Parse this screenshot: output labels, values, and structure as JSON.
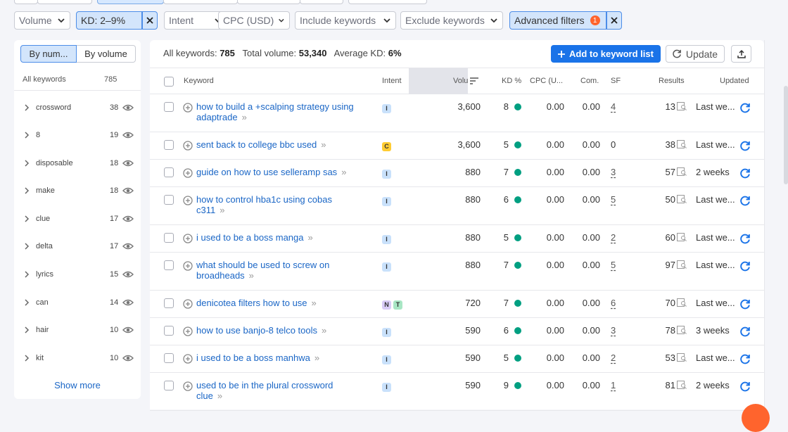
{
  "filters": {
    "volume": "Volume",
    "kd": "KD: 2–9%",
    "intent": "Intent",
    "cpc": "CPC (USD)",
    "include": "Include keywords",
    "exclude": "Exclude keywords",
    "advanced": "Advanced filters",
    "advanced_count": "1"
  },
  "left_panel": {
    "toggle_by_number": "By num...",
    "toggle_by_volume": "By volume",
    "header_label": "All keywords",
    "header_count": "785",
    "groups": [
      {
        "word": "crossword",
        "count": "38"
      },
      {
        "word": "8",
        "count": "19"
      },
      {
        "word": "disposable",
        "count": "18"
      },
      {
        "word": "make",
        "count": "18"
      },
      {
        "word": "clue",
        "count": "17"
      },
      {
        "word": "delta",
        "count": "17"
      },
      {
        "word": "lyrics",
        "count": "15"
      },
      {
        "word": "can",
        "count": "14"
      },
      {
        "word": "hair",
        "count": "10"
      },
      {
        "word": "kit",
        "count": "10"
      }
    ],
    "show_more": "Show more"
  },
  "summary": {
    "all_keywords_label": "All keywords:",
    "all_keywords_value": "785",
    "total_volume_label": "Total volume:",
    "total_volume_value": "53,340",
    "avg_kd_label": "Average KD:",
    "avg_kd_value": "6%"
  },
  "actions": {
    "add_to_list": "Add to keyword list",
    "update": "Update"
  },
  "columns": {
    "keyword": "Keyword",
    "intent": "Intent",
    "volume": "Volu",
    "kd": "KD %",
    "cpc": "CPC (U...",
    "com": "Com.",
    "sf": "SF",
    "results": "Results",
    "updated": "Updated"
  },
  "rows": [
    {
      "kw1": "how to build a +scalping strategy using",
      "kw2": "adaptrade",
      "intents": [
        "I"
      ],
      "volume": "3,600",
      "kd": "8",
      "cpc": "0.00",
      "com": "0.00",
      "sf": "4",
      "results": "13",
      "updated": "Last we..."
    },
    {
      "kw1": "sent back to college bbc used",
      "kw2": "",
      "intents": [
        "C"
      ],
      "volume": "3,600",
      "kd": "5",
      "cpc": "0.00",
      "com": "0.00",
      "sf": "0",
      "results": "38",
      "updated": "Last we..."
    },
    {
      "kw1": "guide on how to use selleramp sas",
      "kw2": "",
      "intents": [
        "I"
      ],
      "volume": "880",
      "kd": "7",
      "cpc": "0.00",
      "com": "0.00",
      "sf": "3",
      "results": "57",
      "updated": "2 weeks"
    },
    {
      "kw1": "how to control hba1c using cobas",
      "kw2": "c311",
      "intents": [
        "I"
      ],
      "volume": "880",
      "kd": "6",
      "cpc": "0.00",
      "com": "0.00",
      "sf": "5",
      "results": "50",
      "updated": "Last we..."
    },
    {
      "kw1": "i used to be a boss manga",
      "kw2": "",
      "intents": [
        "I"
      ],
      "volume": "880",
      "kd": "5",
      "cpc": "0.00",
      "com": "0.00",
      "sf": "2",
      "results": "60",
      "updated": "Last we..."
    },
    {
      "kw1": "what should be used to screw on",
      "kw2": "broadheads",
      "intents": [
        "I"
      ],
      "volume": "880",
      "kd": "7",
      "cpc": "0.00",
      "com": "0.00",
      "sf": "5",
      "results": "97",
      "updated": "Last we..."
    },
    {
      "kw1": "denicotea filters how to use",
      "kw2": "",
      "intents": [
        "N",
        "T"
      ],
      "volume": "720",
      "kd": "7",
      "cpc": "0.00",
      "com": "0.00",
      "sf": "6",
      "results": "70",
      "updated": "Last we..."
    },
    {
      "kw1": "how to use banjo-8 telco tools",
      "kw2": "",
      "intents": [
        "I"
      ],
      "volume": "590",
      "kd": "6",
      "cpc": "0.00",
      "com": "0.00",
      "sf": "3",
      "results": "78",
      "updated": "3 weeks"
    },
    {
      "kw1": "i used to be a boss manhwa",
      "kw2": "",
      "intents": [
        "I"
      ],
      "volume": "590",
      "kd": "5",
      "cpc": "0.00",
      "com": "0.00",
      "sf": "2",
      "results": "53",
      "updated": "Last we..."
    },
    {
      "kw1": "used to be in the plural crossword",
      "kw2": "clue",
      "intents": [
        "I"
      ],
      "volume": "590",
      "kd": "9",
      "cpc": "0.00",
      "com": "0.00",
      "sf": "1",
      "results": "81",
      "updated": "2 weeks"
    }
  ],
  "colors": {
    "accent": "#1a73e8",
    "kd_dot": "#009f81",
    "intent_I": "#c9e1fb",
    "intent_C": "#ffcc33",
    "intent_N": "#d9ccf7",
    "intent_T": "#a8e6c4",
    "badge": "#ff642d"
  }
}
